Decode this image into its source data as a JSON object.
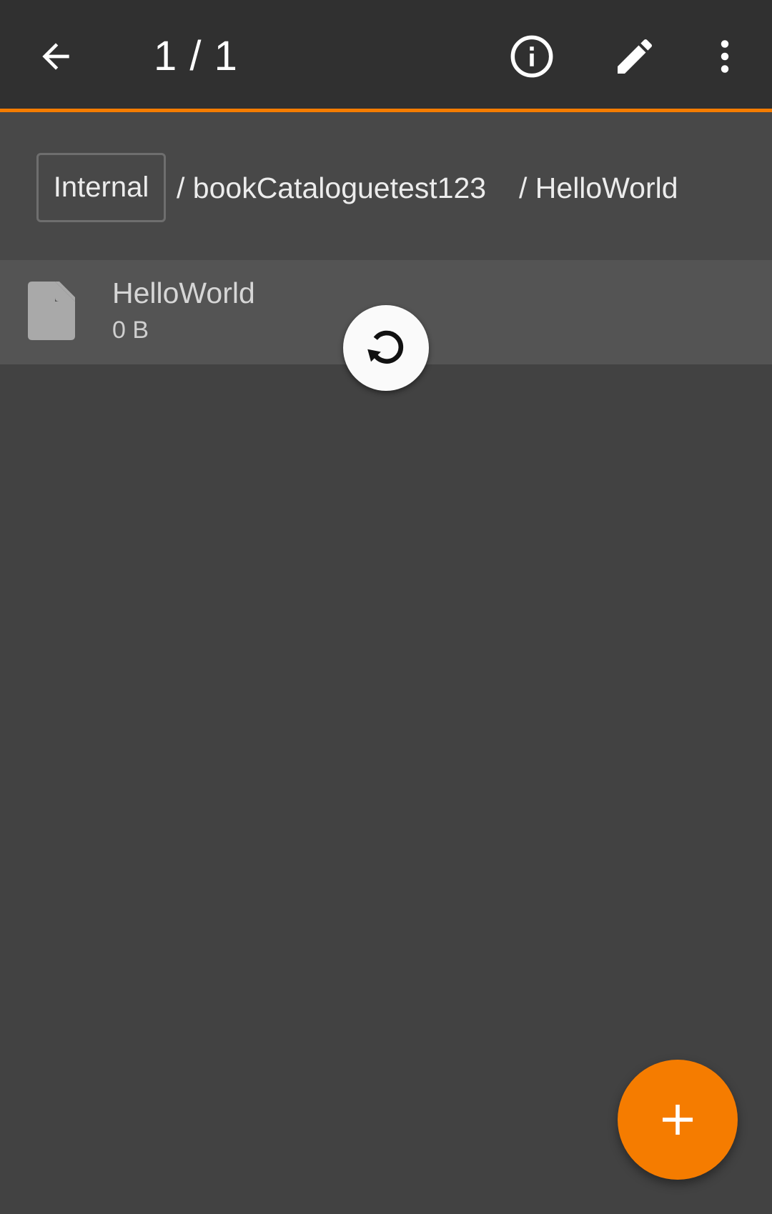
{
  "appbar": {
    "title": "1 / 1",
    "icons": {
      "back": "arrow-back-icon",
      "info": "info-icon",
      "edit": "pencil-icon",
      "more": "more-vert-icon"
    },
    "accent_color": "#f57c00",
    "background_color": "#303030"
  },
  "path": {
    "root_label": "Internal",
    "segments": [
      "/ bookCataloguetest123",
      "/ HelloWorld"
    ]
  },
  "files": [
    {
      "name": "HelloWorld",
      "size": "0 B",
      "icon": "file-icon"
    }
  ],
  "refresh": {
    "icon": "refresh-icon"
  },
  "fab": {
    "icon": "plus-icon",
    "color": "#f57c00"
  }
}
